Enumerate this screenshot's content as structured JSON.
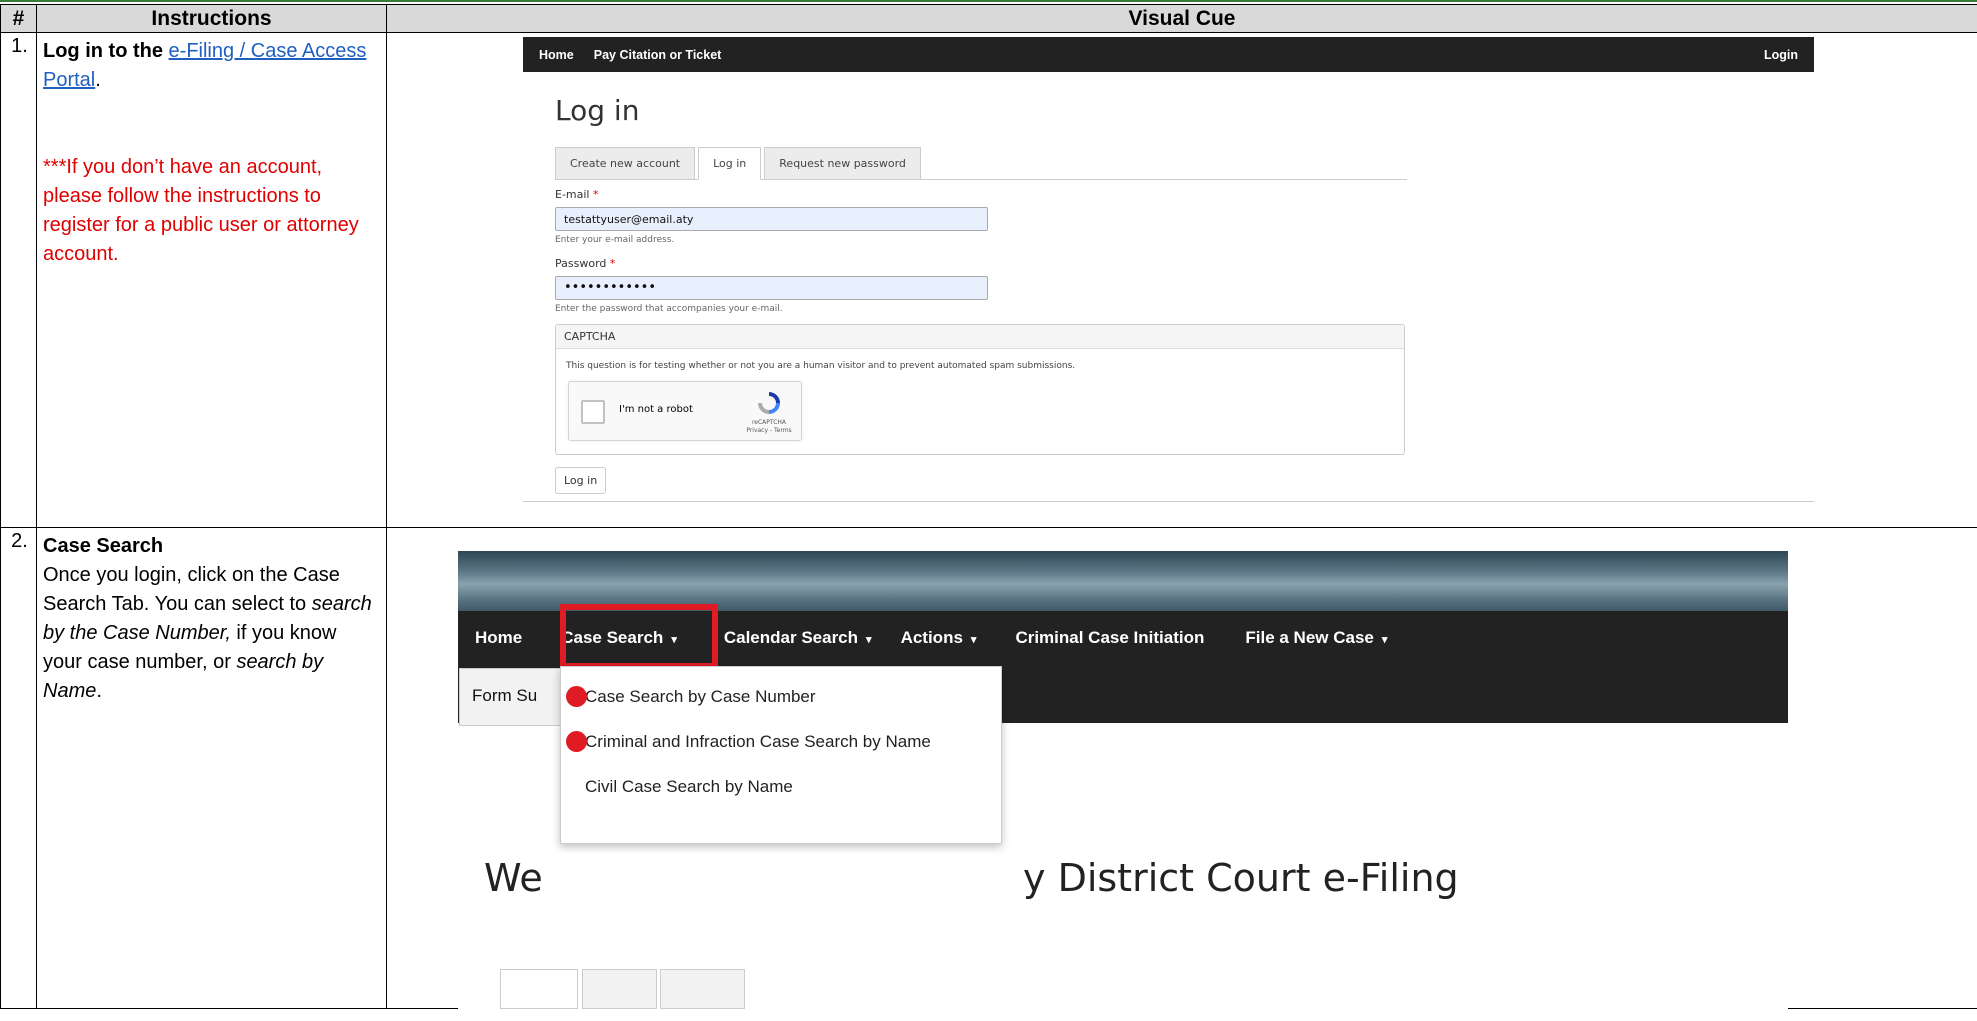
{
  "table": {
    "headers": [
      "#",
      "Instructions",
      "Visual Cue"
    ]
  },
  "steps": [
    {
      "number": "1.",
      "title": "Log in to the",
      "link": "e-Filing / Case Access Portal",
      "link_after": ".",
      "note": "***If you don’t have an account, please follow the instructions to register for a public user or attorney account."
    },
    {
      "number": "2.",
      "title": "Case Search",
      "text_1": "Once you login, click on the Case Search Tab. You can select to ",
      "em_1": "search by the Case Number,",
      "text_2": " if you know your case number, or ",
      "em_2": "search by Name",
      "text_3": "."
    }
  ],
  "screenshot1": {
    "nav_items": [
      "Home",
      "Pay Citation or Ticket"
    ],
    "nav_login": "Login",
    "page_title": "Log in",
    "tabs": [
      "Create new account",
      "Log in",
      "Request new password"
    ],
    "email_label": "E-mail",
    "email_value": "testattyuser@email.aty",
    "email_help": "Enter your e-mail address.",
    "password_label": "Password",
    "password_value": "••••••••••••",
    "password_help": "Enter the password that accompanies your e-mail.",
    "required_mark": "*",
    "captcha_title": "CAPTCHA",
    "captcha_text": "This question is for testing whether or not you are a human visitor and to prevent automated spam submissions.",
    "captcha_check": "I'm not a robot",
    "recaptcha_brand": "reCAPTCHA",
    "recaptcha_links": "Privacy - Terms",
    "login_button": "Log in"
  },
  "screenshot2": {
    "nav_items": [
      "Home",
      "Case Search",
      "Calendar Search",
      "Actions",
      "Criminal Case Initiation",
      "File a New Case"
    ],
    "dropdown_caret": "▾",
    "sub_tab": "Form Su",
    "dropdown_items": [
      "Case Search by Case Number",
      "Criminal and Infraction Case Search by Name",
      "Civil Case Search by Name"
    ],
    "welcome_left": "We",
    "welcome_right": "y District Court e-Filing",
    "colors": {
      "highlight": "#e01b24",
      "nav_bg": "#222222"
    }
  }
}
